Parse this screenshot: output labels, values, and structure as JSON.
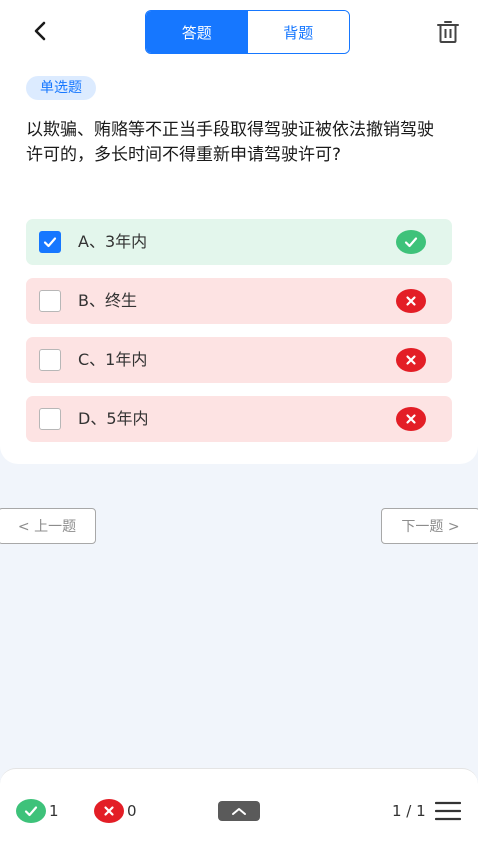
{
  "header": {
    "tabs": [
      {
        "label": "答题",
        "active": true
      },
      {
        "label": "背题",
        "active": false
      }
    ],
    "icons": {
      "back": "chevron-left-icon",
      "delete": "trash-icon"
    }
  },
  "question": {
    "type_badge": "单选题",
    "text": "以欺骗、贿赂等不正当手段取得驾驶证被依法撤销驾驶许可的，多长时间不得重新申请驾驶许可?",
    "options": [
      {
        "label": "A、3年内",
        "checked": true,
        "result": "correct"
      },
      {
        "label": "B、终生",
        "checked": false,
        "result": "wrong"
      },
      {
        "label": "C、1年内",
        "checked": false,
        "result": "wrong"
      },
      {
        "label": "D、5年内",
        "checked": false,
        "result": "wrong"
      }
    ]
  },
  "nav": {
    "prev_label": "< 上一题",
    "next_label": "下一题 >"
  },
  "footer": {
    "correct_count": "1",
    "wrong_count": "0",
    "page_indicator": "1 / 1"
  },
  "colors": {
    "accent": "#1677ff",
    "correct": "#3ec27a",
    "wrong": "#e31e26",
    "correct_bg": "#e3f6ec",
    "wrong_bg": "#fde3e3"
  }
}
